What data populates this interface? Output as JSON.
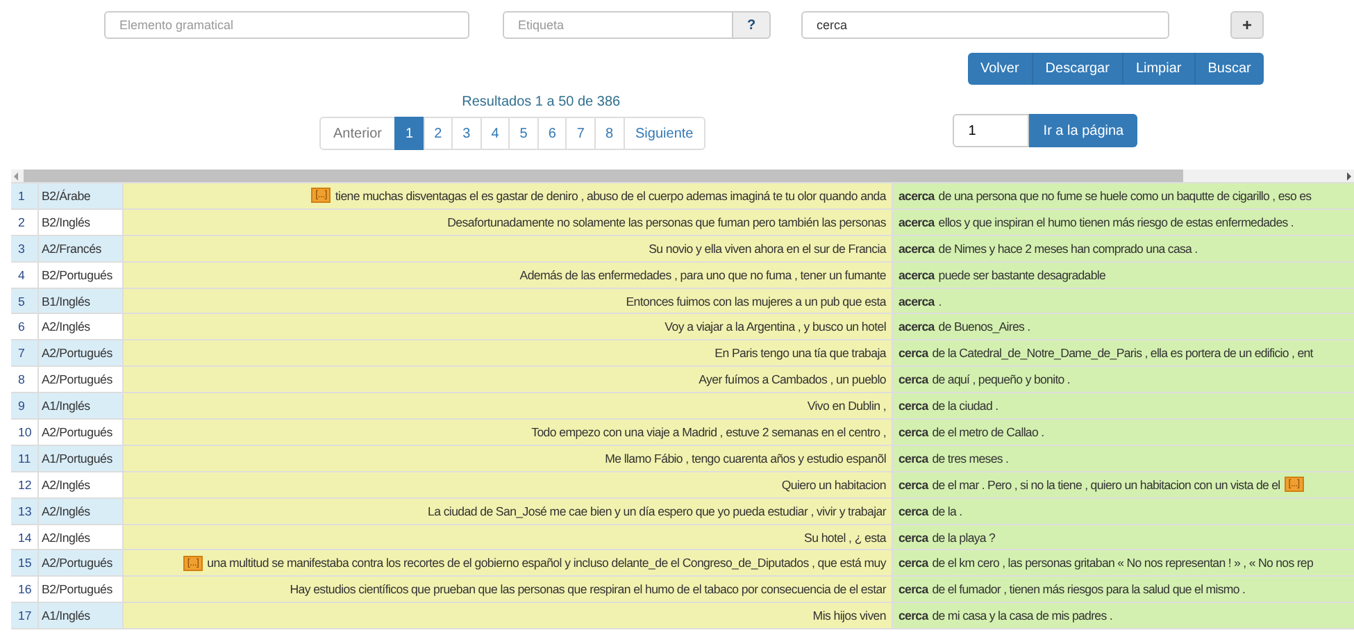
{
  "search": {
    "fields": [
      {
        "placeholder": "Elemento gramatical"
      },
      {
        "placeholder": "Etiqueta",
        "help": "?"
      },
      {
        "value": "cerca",
        "add": "+"
      }
    ]
  },
  "actions": [
    "Volver",
    "Descargar",
    "Limpiar",
    "Buscar"
  ],
  "results_summary": "Resultados 1 a 50 de 386",
  "pagination": {
    "previous": "Anterior",
    "next": "Siguiente",
    "pages": [
      {
        "label": "1",
        "selected": true
      },
      {
        "label": "2",
        "selected": false
      },
      {
        "label": "3",
        "selected": false
      },
      {
        "label": "4",
        "selected": false
      },
      {
        "label": "5",
        "selected": false
      },
      {
        "label": "6",
        "selected": false
      },
      {
        "label": "7",
        "selected": false
      },
      {
        "label": "8",
        "selected": false
      }
    ]
  },
  "goto": {
    "value": "1",
    "button": "Ir a la página"
  },
  "table": {
    "rows": [
      {
        "n": "1",
        "level": "B2/Árabe",
        "left_badge": "[...]",
        "left": "tiene muchas disventagas el es gastar de deniro , abuso de el cuerpo ademas imaginá te tu olor quando anda",
        "keyword": "acerca",
        "right": "de una persona que no fume se huele como un baqutte de cigarillo , eso es"
      },
      {
        "n": "2",
        "level": "B2/Inglés",
        "left": "Desafortunadamente no solamente las personas que fuman pero también las personas",
        "keyword": "acerca",
        "right": "ellos y que inspiran el humo tienen más riesgo de estas enfermedades ."
      },
      {
        "n": "3",
        "level": "A2/Francés",
        "left": "Su novio y ella viven ahora en el sur de Francia",
        "keyword": "acerca",
        "right": "de Nimes y hace 2 meses han comprado una casa ."
      },
      {
        "n": "4",
        "level": "B2/Portugués",
        "left": "Además de las enfermedades , para uno que no fuma , tener un fumante",
        "keyword": "acerca",
        "right": "puede ser bastante desagradable"
      },
      {
        "n": "5",
        "level": "B1/Inglés",
        "left": "Entonces fuimos con las mujeres a un pub que esta",
        "keyword": "acerca",
        "right": "."
      },
      {
        "n": "6",
        "level": "A2/Inglés",
        "left": "Voy a viajar a la Argentina , y busco un hotel",
        "keyword": "acerca",
        "right": "de Buenos_Aires ."
      },
      {
        "n": "7",
        "level": "A2/Portugués",
        "left": "En Paris tengo una tía que trabaja",
        "keyword": "cerca",
        "right": "de la Catedral_de_Notre_Dame_de_Paris , ella es portera de un edificio , ent"
      },
      {
        "n": "8",
        "level": "A2/Portugués",
        "left": "Ayer fuímos a Cambados , un pueblo",
        "keyword": "cerca",
        "right": "de aquí , pequeño y bonito ."
      },
      {
        "n": "9",
        "level": "A1/Inglés",
        "left": "Vivo en Dublin ,",
        "keyword": "cerca",
        "right": "de la ciudad ."
      },
      {
        "n": "10",
        "level": "A2/Portugués",
        "left": "Todo empezo con una viaje a Madrid , estuve 2 semanas en el centro ,",
        "keyword": "cerca",
        "right": "de el metro de Callao ."
      },
      {
        "n": "11",
        "level": "A1/Portugués",
        "left": "Me llamo Fábio , tengo cuarenta años y estudio espanõl",
        "keyword": "cerca",
        "right": "de tres meses ."
      },
      {
        "n": "12",
        "level": "A2/Inglés",
        "left": "Quiero un habitacion",
        "keyword": "cerca",
        "right": "de el mar . Pero , si no la tiene , quiero un habitacion con un vista de el",
        "right_badge": "[...]"
      },
      {
        "n": "13",
        "level": "A2/Inglés",
        "left": "La ciudad de San_José me cae bien y un día espero que yo pueda estudiar , vivir y trabajar",
        "keyword": "cerca",
        "right": "de la ."
      },
      {
        "n": "14",
        "level": "A2/Inglés",
        "left": "Su hotel , ¿ esta",
        "keyword": "cerca",
        "right": "de la playa ?"
      },
      {
        "n": "15",
        "level": "A2/Portugués",
        "left_badge": "[...]",
        "left": "una multitud se manifestaba contra los recortes de el gobierno español y incluso delante_de el Congreso_de_Diputados , que está muy",
        "keyword": "cerca",
        "right": "de el km cero , las personas gritaban « No nos representan ! » , « No nos rep"
      },
      {
        "n": "16",
        "level": "B2/Portugués",
        "left": "Hay estudios científicos que prueban que las personas que respiran el humo de el tabaco por consecuencia de el estar",
        "keyword": "cerca",
        "right": "de el fumador , tienen más riesgos para la salud que el mismo ."
      },
      {
        "n": "17",
        "level": "A1/Inglés",
        "left": "Mis hijos viven",
        "keyword": "cerca",
        "right": "de mi casa y la casa de mis padres ."
      }
    ]
  }
}
